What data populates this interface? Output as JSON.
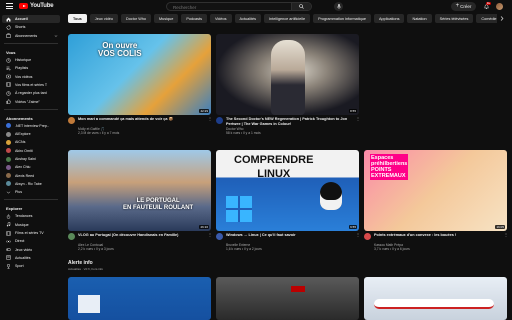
{
  "header": {
    "logo_text": "YouTube",
    "logo_country": "CH",
    "search_placeholder": "Rechercher",
    "create_label": "Créer",
    "notif_count": "9+"
  },
  "sidebar": {
    "top": [
      {
        "label": "Accueil",
        "icon": "home-icon",
        "active": true
      },
      {
        "label": "Shorts",
        "icon": "shorts-icon"
      },
      {
        "label": "Abonnements",
        "icon": "subscriptions-icon"
      }
    ],
    "you_label": "Vous",
    "you": [
      {
        "label": "Historique",
        "icon": "history-icon"
      },
      {
        "label": "Playlists",
        "icon": "playlist-icon"
      },
      {
        "label": "Vos vidéos",
        "icon": "video-icon"
      },
      {
        "label": "Vos films et séries T",
        "icon": "film-icon"
      },
      {
        "label": "À regarder plus tard",
        "icon": "clock-icon"
      },
      {
        "label": "Vidéos \"J'aime\"",
        "icon": "like-icon"
      }
    ],
    "subs_label": "Abonnements",
    "subs": [
      {
        "label": ".NET interview Prep..",
        "color": "#3a6fd8"
      },
      {
        "label": "AIExplore",
        "color": "#8a8a8a"
      },
      {
        "label": "AICNs",
        "color": "#d8a23a"
      },
      {
        "label": "Akiro Omiti",
        "color": "#c04a4a"
      },
      {
        "label": "Akshay Saini",
        "color": "#4a7a4a"
      },
      {
        "label": "Alex Chiu",
        "color": "#7a5a8a"
      },
      {
        "label": "Alexis Reed",
        "color": "#8a6a4a"
      },
      {
        "label": "Alwyn - Ric Tabe",
        "color": "#5a8a9a"
      }
    ],
    "more_label": "Plus",
    "explore_label": "Explorer",
    "explore": [
      {
        "label": "Tendances",
        "icon": "flame-icon"
      },
      {
        "label": "Musique",
        "icon": "music-icon"
      },
      {
        "label": "Films et séries TV",
        "icon": "film-icon"
      },
      {
        "label": "Direct",
        "icon": "live-icon"
      },
      {
        "label": "Jeux vidéo",
        "icon": "gaming-icon"
      },
      {
        "label": "Actualités",
        "icon": "news-icon"
      },
      {
        "label": "Sport",
        "icon": "trophy-icon"
      }
    ]
  },
  "chips": [
    "Tous",
    "Jeux vidéo",
    "Doctor Who",
    "Musique",
    "Podcasts",
    "Vidéos",
    "Actualités",
    "Intelligence artificielle",
    "Programmation informatique",
    "Applications",
    "Natation",
    "Séries télévisées",
    "Comédie à sketches",
    "En direct"
  ],
  "videos": [
    {
      "title": "Mon mari a commandé ça mais attends de voir ça 📦",
      "channel": "Molly et Gaëlle 🎵",
      "stats": "2,3 M de vues • Il y a 7 mois",
      "duration": "42:29",
      "avatar": "#c07a3a",
      "overlay": "On ouvre\nVOS COLIS"
    },
    {
      "title": "The Second Doctor's NEW Regeneration | Patrick Troughton to Jon Pertwee | The War Games in Colour!",
      "channel": "Doctor Who",
      "stats": "58 k vues • Il y a 1 mois",
      "duration": "8:55",
      "avatar": "#1d3d8a",
      "overlay": ""
    },
    {
      "title": "VLOG au Portugal (On découvre Handisnais en Famille)",
      "channel": "Alex Le Contoual",
      "stats": "2,2 k vues • Il y a 3 jours",
      "duration": "26:16",
      "avatar": "#5a8a5a",
      "overlay": "LE PORTUGAL\nEN FAUTEUIL ROULANT"
    },
    {
      "title": "Windows → Linux | Ce qu'il faut savoir",
      "channel": "Bruxelle Externe",
      "stats": "1,6 k vues • Il y a 2 jours",
      "duration": "9:55",
      "avatar": "#3a5aaa",
      "overlay": "COMPRENDRE\nLINUX"
    },
    {
      "title": "Points extrémaux d'un convexe : les bouées !",
      "channel": "Kassou Math Prépa",
      "stats": "3,7 k vues • Il y a 6 jours",
      "duration": "16:05",
      "avatar": "#d84a4a",
      "overlay": "Espaces\npréhilbertiens\nPOINTS\nEXTREMAUX"
    }
  ],
  "shelf": {
    "title": "Alerte info",
    "sub": "Actualités · Vd fr, hors.info"
  },
  "colors": {
    "bg": "#0f0f0f",
    "accent": "#ff0000",
    "chip": "#272727"
  }
}
